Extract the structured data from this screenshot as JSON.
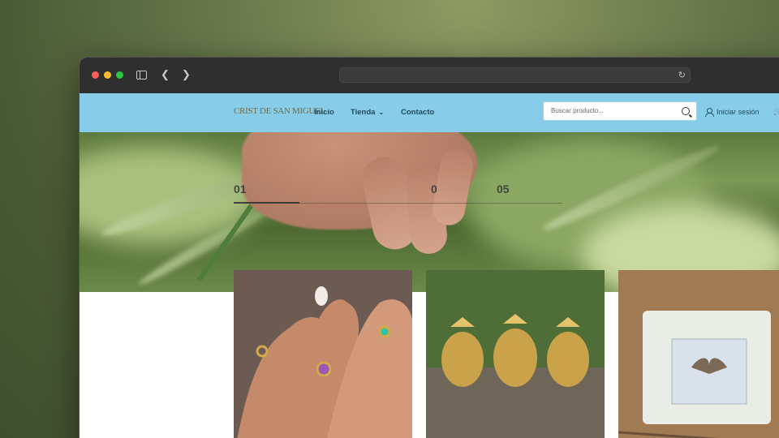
{
  "browser": {
    "url": ""
  },
  "site": {
    "logo": "CRIST DE SAN MIGUEL",
    "nav": [
      {
        "label": "Inicio"
      },
      {
        "label": "Tienda"
      },
      {
        "label": "Contacto"
      }
    ],
    "search": {
      "placeholder": "Buscar producto..."
    },
    "login_label": "Iniciar sesión"
  },
  "hero": {
    "slides": [
      "01",
      "",
      "",
      "0",
      "05"
    ]
  },
  "products": [
    {
      "name": "rings-photo"
    },
    {
      "name": "ganesha-figures-photo"
    },
    {
      "name": "candle-photo"
    }
  ],
  "colors": {
    "header": "#87cdea",
    "nav_text": "#1f4a5f",
    "logo": "#7c6a3c"
  }
}
